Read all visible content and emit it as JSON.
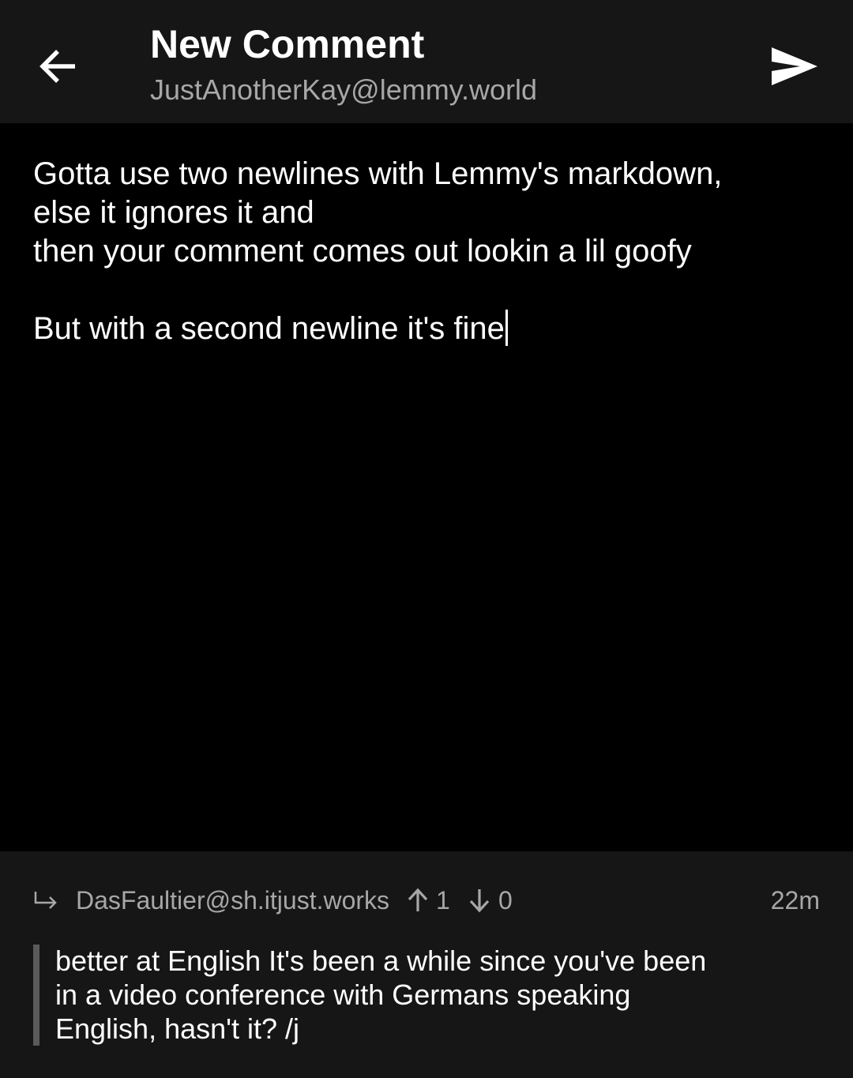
{
  "header": {
    "title": "New Comment",
    "account": "JustAnotherKay@lemmy.world",
    "back_icon": "arrow-left-icon",
    "send_icon": "send-icon"
  },
  "editor": {
    "lines": [
      "Gotta use two newlines with Lemmy's markdown,",
      "else it ignores it and",
      "then your comment comes out lookin a lil goofy",
      "",
      "But with a second newline it's fine"
    ]
  },
  "reply_to": {
    "reply_icon": "reply-arrow-icon",
    "author": "DasFaultier@sh.itjust.works",
    "upvotes": "1",
    "downvotes": "0",
    "age": "22m",
    "quote_lines": [
      "better at English It's been a while since you've been",
      "in a video conference with Germans speaking",
      "English, hasn't it? /j"
    ]
  },
  "colors": {
    "topbar_bg": "#161616",
    "editor_bg": "#000000",
    "secondary_text": "#a7a7a7",
    "quote_bar": "#5a5a5a"
  }
}
